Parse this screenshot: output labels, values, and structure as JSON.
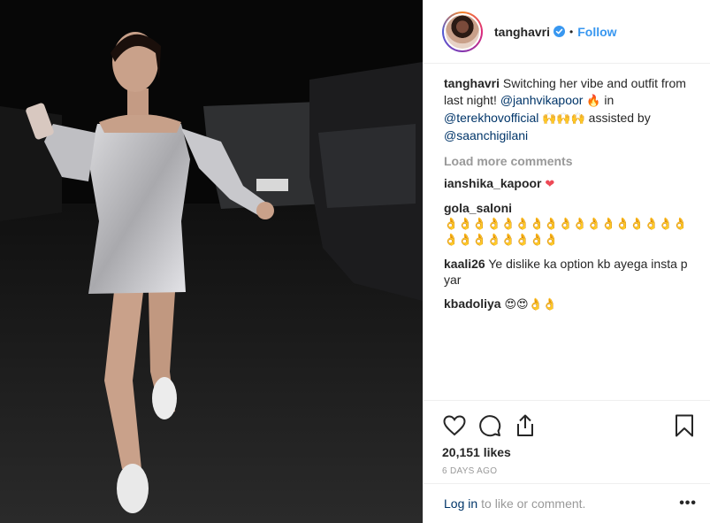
{
  "post": {
    "author": "tanghavri",
    "follow_label": "Follow",
    "separator": "•",
    "caption_author": "tanghavri",
    "caption_parts": {
      "text1": "Switching her vibe and outfit from last night! ",
      "mention1": "@janhvikapoor",
      "text2": " in ",
      "mention2": "@terekhovofficial",
      "text3": " assisted by ",
      "mention3": "@saanchigilani"
    },
    "load_more": "Load more comments",
    "comments": [
      {
        "user": "ianshika_kapoor",
        "text": "❤"
      },
      {
        "user": "gola_saloni",
        "text": "👌👌👌👌👌👌👌👌👌👌👌👌👌👌👌👌👌👌👌👌👌👌👌👌👌"
      },
      {
        "user": "kaali26",
        "text": "Ye dislike ka option kb ayega insta p yar"
      },
      {
        "user": "kbadoliya",
        "text": "😍😍👌👌"
      }
    ],
    "likes": "20,151 likes",
    "timestamp": "6 DAYS AGO",
    "footer": {
      "login": "Log in",
      "rest": "to like or comment.",
      "more": "•••"
    },
    "icons": {
      "verified": "verified-badge-icon",
      "like": "heart-icon",
      "comment": "comment-bubble-icon",
      "share": "share-icon",
      "save": "bookmark-icon"
    },
    "colors": {
      "link_blue": "#3897f0",
      "mention_blue": "#003569",
      "muted": "#999999",
      "heart_red": "#ed4956"
    }
  }
}
